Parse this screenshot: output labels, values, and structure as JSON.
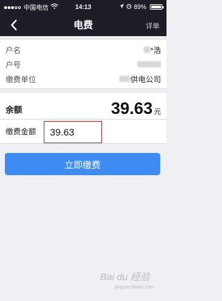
{
  "status_bar": {
    "carrier": "中国电信",
    "time": "14:13",
    "battery": "89%",
    "battery_level": 0.89
  },
  "nav": {
    "title": "电费",
    "right_label": "详单"
  },
  "info": {
    "rows": [
      {
        "label": "户名",
        "value": "*浩"
      },
      {
        "label": "户号",
        "value": ""
      },
      {
        "label": "缴费单位",
        "value": "供电公司"
      }
    ]
  },
  "balance": {
    "label": "余额",
    "amount": "39.63",
    "unit": "元"
  },
  "payment": {
    "label": "缴费金额",
    "value": "39.63"
  },
  "actions": {
    "pay_label": "立即缴费"
  },
  "watermark": {
    "text": "Bai du 经验",
    "url": "jingyan.baidu.com"
  },
  "colors": {
    "bar_bg": "#1c1d27",
    "button": "#3e8cf3",
    "input_border": "#c3322f"
  }
}
